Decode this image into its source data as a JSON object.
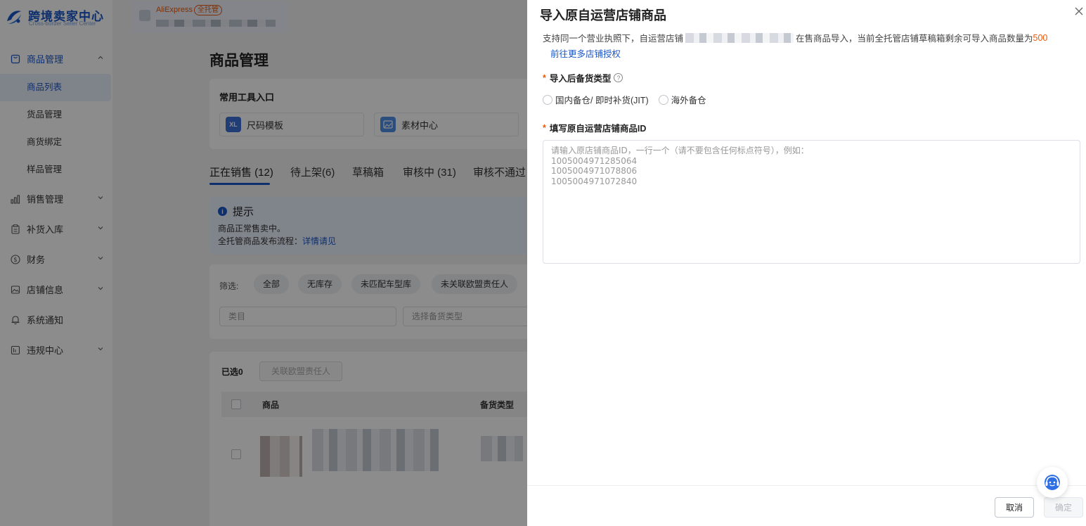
{
  "brand": {
    "title": "跨境卖家中心",
    "subtitle": "Cross-border Seller Center"
  },
  "shop": {
    "platform": "AliExpress",
    "badge": "全托管"
  },
  "sidebar": {
    "items": [
      {
        "label": "商品管理",
        "open": true,
        "children": [
          "商品列表",
          "货品管理",
          "商货绑定",
          "样品管理"
        ],
        "active_child": "商品列表"
      },
      {
        "label": "销售管理"
      },
      {
        "label": "补货入库"
      },
      {
        "label": "财务"
      },
      {
        "label": "店铺信息"
      },
      {
        "label": "系统通知"
      },
      {
        "label": "违规中心"
      }
    ]
  },
  "main": {
    "page_title": "商品管理",
    "tools": {
      "title": "常用工具入口",
      "items": [
        "尺码模板",
        "素材中心"
      ]
    },
    "tabs": [
      {
        "label": "正在销售 (12)",
        "active": true
      },
      {
        "label": "待上架(6)"
      },
      {
        "label": "草稿箱"
      },
      {
        "label": "审核中 (31)"
      },
      {
        "label": "审核不通过"
      }
    ],
    "tip": {
      "title": "提示",
      "line1": "商品正常售卖中。",
      "line2_prefix": "全托管商品发布流程：",
      "line2_link": "详情请见"
    },
    "filter": {
      "label": "筛选:",
      "chips": [
        "全部",
        "无库存",
        "未匹配车型库",
        "未关联欧盟责任人"
      ],
      "category_placeholder": "类目",
      "stock_type_placeholder": "选择备货类型"
    },
    "table": {
      "selected_label": "已选",
      "selected_count": "0",
      "batch_button": "关联欧盟责任人",
      "columns": [
        "商品",
        "备货类型"
      ]
    }
  },
  "drawer": {
    "title": "导入原自运营店铺商品",
    "desc_prefix": "支持同一个营业执照下，自运营店铺",
    "desc_middle": "在售商品导入，当前全托管店铺草稿箱剩余可导入商品数量为",
    "desc_number": "500",
    "more_link": "前往更多店铺授权",
    "stock_type": {
      "label": "导入后备货类型",
      "options": [
        "国内备仓/ 即时补货(JIT)",
        "海外备仓"
      ]
    },
    "ids_field": {
      "label": "填写原自运营店铺商品ID",
      "placeholder": "请输入原店铺商品ID，一行一个（请不要包含任何标点符号），例如：\n1005004971285064\n1005004971078806\n1005004971072840"
    },
    "buttons": {
      "cancel": "取消",
      "ok": "确定"
    }
  }
}
